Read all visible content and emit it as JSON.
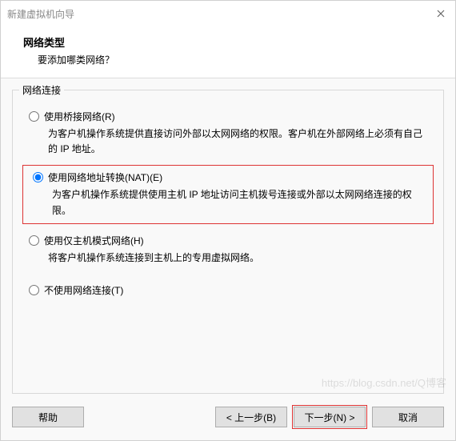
{
  "window": {
    "title": "新建虚拟机向导"
  },
  "header": {
    "title": "网络类型",
    "subtitle": "要添加哪类网络？"
  },
  "fieldset": {
    "legend": "网络连接"
  },
  "options": {
    "bridged": {
      "label": "使用桥接网络(R)",
      "desc": "为客户机操作系统提供直接访问外部以太网网络的权限。客户机在外部网络上必须有自己的 IP 地址。"
    },
    "nat": {
      "label": "使用网络地址转换(NAT)(E)",
      "desc": "为客户机操作系统提供使用主机 IP 地址访问主机拨号连接或外部以太网网络连接的权限。"
    },
    "hostonly": {
      "label": "使用仅主机模式网络(H)",
      "desc": "将客户机操作系统连接到主机上的专用虚拟网络。"
    },
    "none": {
      "label": "不使用网络连接(T)"
    }
  },
  "buttons": {
    "help": "帮助",
    "back": "< 上一步(B)",
    "next": "下一步(N) >",
    "cancel": "取消"
  },
  "watermark": "https://blog.csdn.net/Q博客"
}
